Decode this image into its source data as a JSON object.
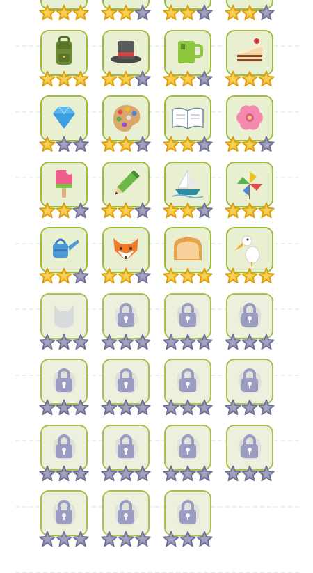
{
  "colors": {
    "star_gold": "#f5c026",
    "star_gold_rim": "#d89a12",
    "star_grey": "#8e8fb0",
    "star_grey_rim": "#6c6d93",
    "tile_bg": "#e9f0d2",
    "tile_border": "#9bbd3d",
    "lock": "#9b9cc1"
  },
  "levels": [
    {
      "icon": "partial-top-icon",
      "stars": 3,
      "locked": false
    },
    {
      "icon": "partial-top-icon",
      "stars": 2,
      "locked": false
    },
    {
      "icon": "partial-top-icon",
      "stars": 2,
      "locked": false
    },
    {
      "icon": "partial-top-icon",
      "stars": 2,
      "locked": false
    },
    {
      "icon": "backpack-icon",
      "stars": 3,
      "locked": false
    },
    {
      "icon": "top-hat-icon",
      "stars": 2,
      "locked": false
    },
    {
      "icon": "mug-icon",
      "stars": 2,
      "locked": false
    },
    {
      "icon": "cake-slice-icon",
      "stars": 3,
      "locked": false
    },
    {
      "icon": "diamond-icon",
      "stars": 1,
      "locked": false
    },
    {
      "icon": "paint-palette-icon",
      "stars": 2,
      "locked": false
    },
    {
      "icon": "open-book-icon",
      "stars": 2,
      "locked": false
    },
    {
      "icon": "flower-icon",
      "stars": 2,
      "locked": false
    },
    {
      "icon": "popsicle-icon",
      "stars": 2,
      "locked": false
    },
    {
      "icon": "pencil-icon",
      "stars": 2,
      "locked": false
    },
    {
      "icon": "sailboat-icon",
      "stars": 2,
      "locked": false
    },
    {
      "icon": "pinwheel-icon",
      "stars": 3,
      "locked": false
    },
    {
      "icon": "watering-can-icon",
      "stars": 2,
      "locked": false
    },
    {
      "icon": "fox-icon",
      "stars": 2,
      "locked": false
    },
    {
      "icon": "bread-icon",
      "stars": 3,
      "locked": false
    },
    {
      "icon": "pelican-icon",
      "stars": 3,
      "locked": false
    },
    {
      "icon": "cat-silhouette-icon",
      "stars": 0,
      "locked": true,
      "showLock": false
    },
    {
      "icon": "lock-icon",
      "stars": 0,
      "locked": true,
      "showLock": true
    },
    {
      "icon": "lock-icon",
      "stars": 0,
      "locked": true,
      "showLock": true
    },
    {
      "icon": "lock-icon",
      "stars": 0,
      "locked": true,
      "showLock": true
    },
    {
      "icon": "lock-icon",
      "stars": 0,
      "locked": true,
      "showLock": true
    },
    {
      "icon": "lock-icon",
      "stars": 0,
      "locked": true,
      "showLock": true
    },
    {
      "icon": "lock-icon",
      "stars": 0,
      "locked": true,
      "showLock": true
    },
    {
      "icon": "lock-icon",
      "stars": 0,
      "locked": true,
      "showLock": true
    },
    {
      "icon": "lock-icon",
      "stars": 0,
      "locked": true,
      "showLock": true
    },
    {
      "icon": "lock-icon",
      "stars": 0,
      "locked": true,
      "showLock": true
    },
    {
      "icon": "lock-icon",
      "stars": 0,
      "locked": true,
      "showLock": true
    },
    {
      "icon": "lock-icon",
      "stars": 0,
      "locked": true,
      "showLock": true
    },
    {
      "icon": "lock-icon",
      "stars": 0,
      "locked": true,
      "showLock": true
    },
    {
      "icon": "lock-icon",
      "stars": 0,
      "locked": true,
      "showLock": true
    },
    {
      "icon": "lock-icon",
      "stars": 0,
      "locked": true,
      "showLock": true
    }
  ]
}
